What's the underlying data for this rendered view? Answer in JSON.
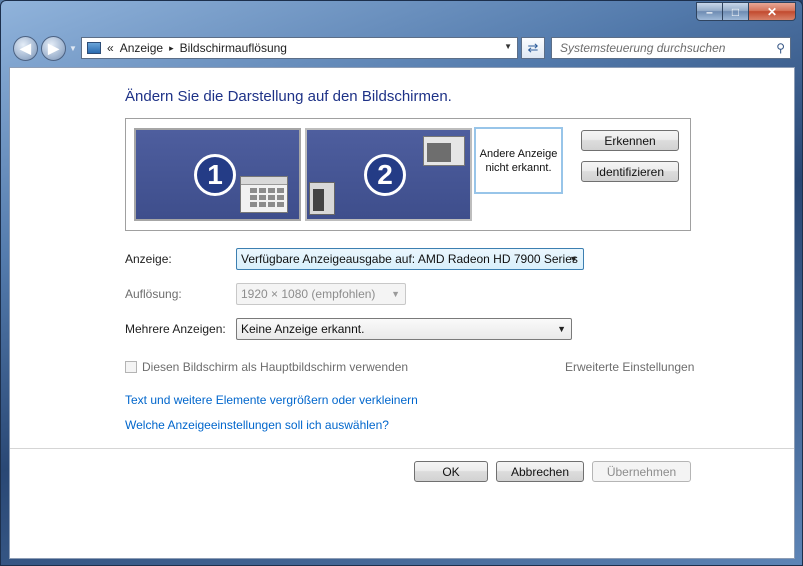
{
  "window": {
    "caption_buttons": {
      "minimize": "–",
      "maximize": "□",
      "close": "✕"
    },
    "nav": {
      "back_icon": "◀",
      "forward_icon": "▶"
    },
    "address": {
      "prefix": "«",
      "crumbs": [
        "Anzeige",
        "Bildschirmauflösung"
      ],
      "separator": "▸"
    },
    "search": {
      "placeholder": "Systemsteuerung durchsuchen"
    }
  },
  "main": {
    "heading": "Ändern Sie die Darstellung auf den Bildschirmen.",
    "monitors": [
      {
        "number": "1"
      },
      {
        "number": "2"
      },
      {
        "text": "Andere Anzeige nicht erkannt."
      }
    ],
    "buttons": {
      "detect": "Erkennen",
      "identify": "Identifizieren"
    },
    "settings": {
      "display_label": "Anzeige:",
      "display_value": "Verfügbare Anzeigeausgabe auf: AMD Radeon HD 7900 Series",
      "resolution_label": "Auflösung:",
      "resolution_value": "1920 × 1080 (empfohlen)",
      "multi_label": "Mehrere Anzeigen:",
      "multi_value": "Keine Anzeige erkannt."
    },
    "primary_checkbox": {
      "label": "Diesen Bildschirm als Hauptbildschirm verwenden",
      "checked": false
    },
    "advanced_link": "Erweiterte Einstellungen",
    "links": [
      "Text und weitere Elemente vergrößern oder verkleinern",
      "Welche Anzeigeeinstellungen soll ich auswählen?"
    ],
    "footer": {
      "ok": "OK",
      "cancel": "Abbrechen",
      "apply": "Übernehmen"
    }
  },
  "colors": {
    "heading": "#1e3287",
    "link": "#0066cc",
    "monitor": "#3e4e8c"
  }
}
